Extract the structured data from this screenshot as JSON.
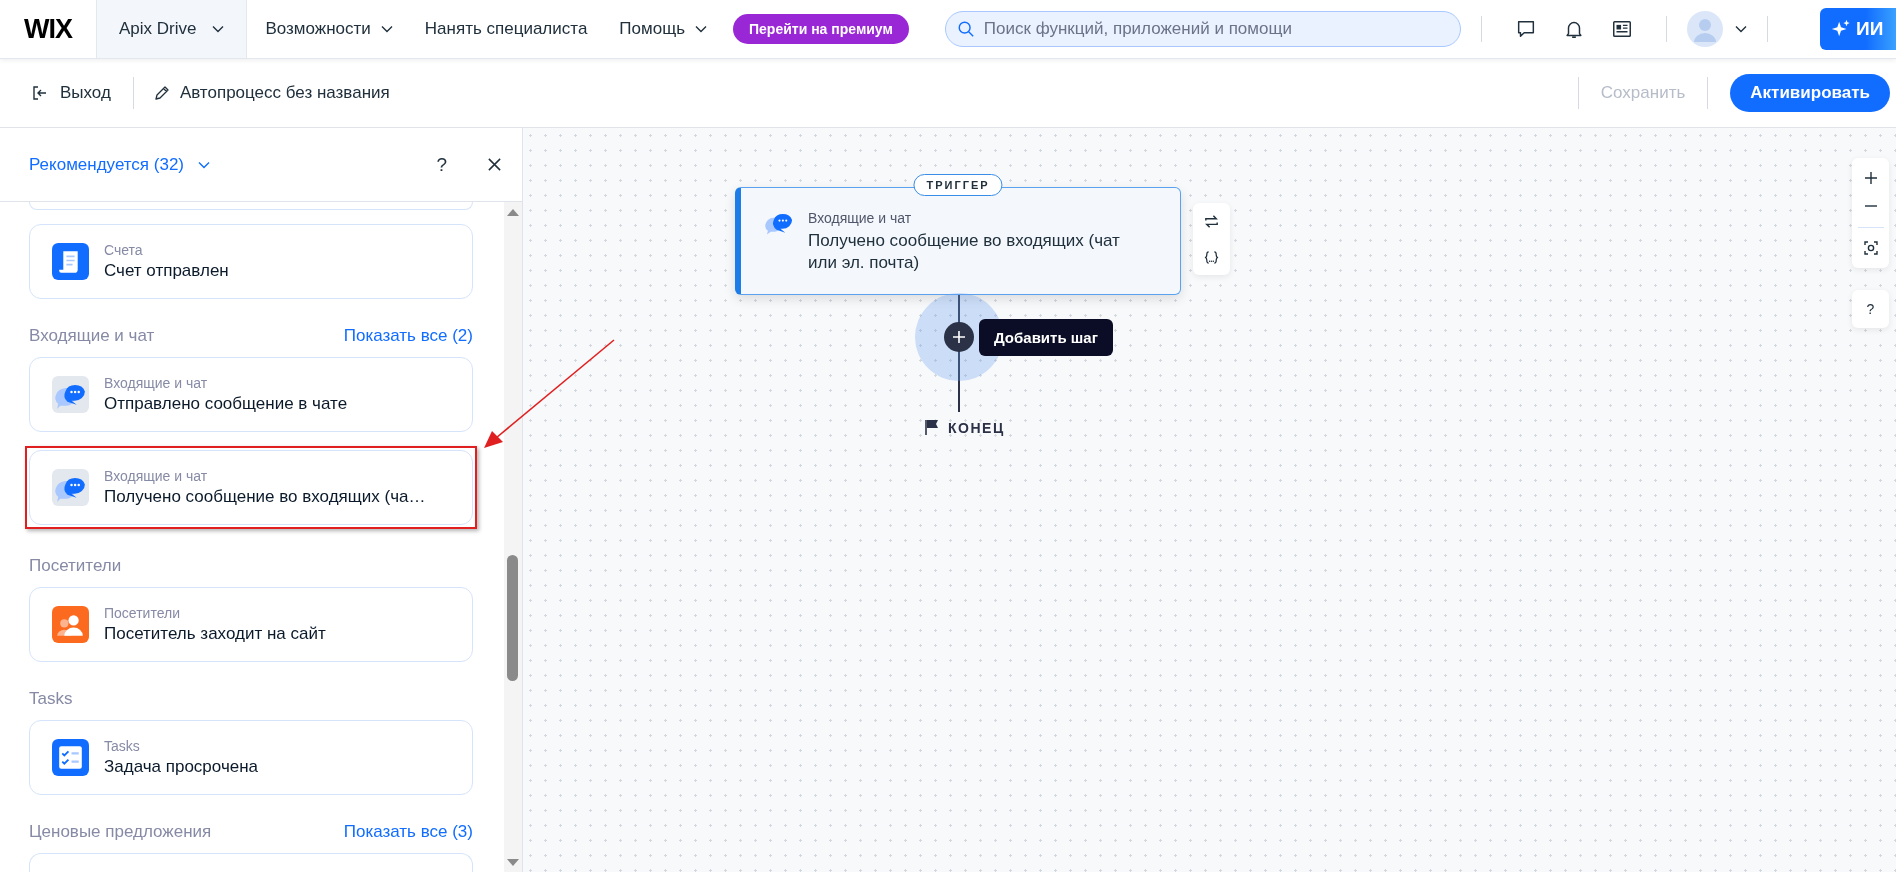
{
  "topbar": {
    "logo": "WIX",
    "site": {
      "label": "Apix Drive",
      "selected": true
    },
    "menu": [
      {
        "label": "Возможности",
        "dropdown": true
      },
      {
        "label": "Нанять специалиста",
        "dropdown": false
      },
      {
        "label": "Помощь",
        "dropdown": true
      }
    ],
    "premium": "Перейти на премиум",
    "search": {
      "placeholder": "Поиск функций, приложений и помощи"
    },
    "ai_button": "ИИ"
  },
  "toolbar": {
    "exit": "Выход",
    "title": "Автопроцесс без названия",
    "save": {
      "label": "Сохранить",
      "disabled": true
    },
    "activate": "Активировать"
  },
  "panel": {
    "filter": "Рекомендуется (32)",
    "help": "?",
    "clipped_above": true,
    "sections": [
      {
        "items": [
          {
            "kind": "invoice",
            "category": "Счета",
            "title": "Счет отправлен",
            "highlighted": false
          }
        ]
      },
      {
        "heading": "Входящие и чат",
        "show_all": "Показать все (2)",
        "items": [
          {
            "kind": "chat",
            "category": "Входящие и чат",
            "title": "Отправлено сообщение в чате",
            "highlighted": false
          },
          {
            "kind": "chat",
            "category": "Входящие и чат",
            "title": "Получено сообщение во входящих (ча…",
            "highlighted": true
          }
        ]
      },
      {
        "heading": "Посетители",
        "items": [
          {
            "kind": "visitors",
            "category": "Посетители",
            "title": "Посетитель заходит на сайт",
            "highlighted": false
          }
        ]
      },
      {
        "heading": "Tasks",
        "items": [
          {
            "kind": "tasks",
            "category": "Tasks",
            "title": "Задача просрочена",
            "highlighted": false
          }
        ]
      },
      {
        "heading": "Ценовые предложения",
        "show_all": "Показать все (3)",
        "more_below": true
      }
    ]
  },
  "canvas": {
    "trigger": {
      "badge": "ТРИГГЕР",
      "category": "Входящие и чат",
      "title": "Получено сообщение во входящих (чат или эл. почта)"
    },
    "add_step": "Добавить шаг",
    "end": "КОНЕЦ",
    "help": "?"
  }
}
